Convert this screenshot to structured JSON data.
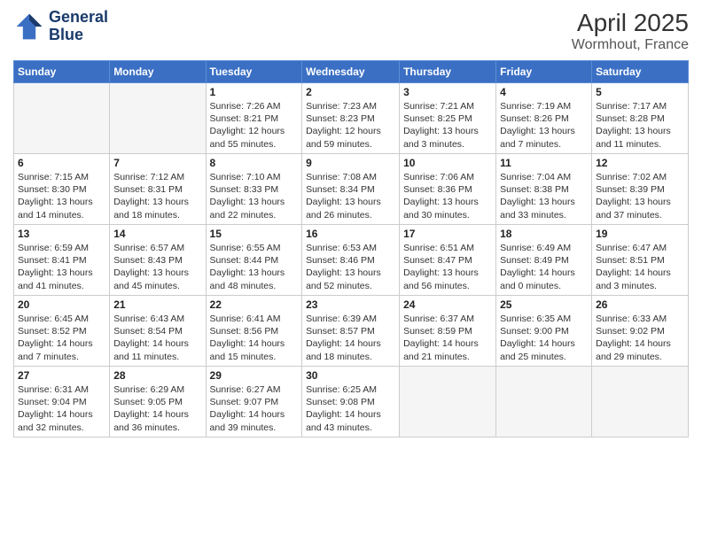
{
  "header": {
    "logo_line1": "General",
    "logo_line2": "Blue",
    "title": "April 2025",
    "subtitle": "Wormhout, France"
  },
  "days_of_week": [
    "Sunday",
    "Monday",
    "Tuesday",
    "Wednesday",
    "Thursday",
    "Friday",
    "Saturday"
  ],
  "weeks": [
    [
      {
        "day": "",
        "detail": ""
      },
      {
        "day": "",
        "detail": ""
      },
      {
        "day": "1",
        "detail": "Sunrise: 7:26 AM\nSunset: 8:21 PM\nDaylight: 12 hours\nand 55 minutes."
      },
      {
        "day": "2",
        "detail": "Sunrise: 7:23 AM\nSunset: 8:23 PM\nDaylight: 12 hours\nand 59 minutes."
      },
      {
        "day": "3",
        "detail": "Sunrise: 7:21 AM\nSunset: 8:25 PM\nDaylight: 13 hours\nand 3 minutes."
      },
      {
        "day": "4",
        "detail": "Sunrise: 7:19 AM\nSunset: 8:26 PM\nDaylight: 13 hours\nand 7 minutes."
      },
      {
        "day": "5",
        "detail": "Sunrise: 7:17 AM\nSunset: 8:28 PM\nDaylight: 13 hours\nand 11 minutes."
      }
    ],
    [
      {
        "day": "6",
        "detail": "Sunrise: 7:15 AM\nSunset: 8:30 PM\nDaylight: 13 hours\nand 14 minutes."
      },
      {
        "day": "7",
        "detail": "Sunrise: 7:12 AM\nSunset: 8:31 PM\nDaylight: 13 hours\nand 18 minutes."
      },
      {
        "day": "8",
        "detail": "Sunrise: 7:10 AM\nSunset: 8:33 PM\nDaylight: 13 hours\nand 22 minutes."
      },
      {
        "day": "9",
        "detail": "Sunrise: 7:08 AM\nSunset: 8:34 PM\nDaylight: 13 hours\nand 26 minutes."
      },
      {
        "day": "10",
        "detail": "Sunrise: 7:06 AM\nSunset: 8:36 PM\nDaylight: 13 hours\nand 30 minutes."
      },
      {
        "day": "11",
        "detail": "Sunrise: 7:04 AM\nSunset: 8:38 PM\nDaylight: 13 hours\nand 33 minutes."
      },
      {
        "day": "12",
        "detail": "Sunrise: 7:02 AM\nSunset: 8:39 PM\nDaylight: 13 hours\nand 37 minutes."
      }
    ],
    [
      {
        "day": "13",
        "detail": "Sunrise: 6:59 AM\nSunset: 8:41 PM\nDaylight: 13 hours\nand 41 minutes."
      },
      {
        "day": "14",
        "detail": "Sunrise: 6:57 AM\nSunset: 8:43 PM\nDaylight: 13 hours\nand 45 minutes."
      },
      {
        "day": "15",
        "detail": "Sunrise: 6:55 AM\nSunset: 8:44 PM\nDaylight: 13 hours\nand 48 minutes."
      },
      {
        "day": "16",
        "detail": "Sunrise: 6:53 AM\nSunset: 8:46 PM\nDaylight: 13 hours\nand 52 minutes."
      },
      {
        "day": "17",
        "detail": "Sunrise: 6:51 AM\nSunset: 8:47 PM\nDaylight: 13 hours\nand 56 minutes."
      },
      {
        "day": "18",
        "detail": "Sunrise: 6:49 AM\nSunset: 8:49 PM\nDaylight: 14 hours\nand 0 minutes."
      },
      {
        "day": "19",
        "detail": "Sunrise: 6:47 AM\nSunset: 8:51 PM\nDaylight: 14 hours\nand 3 minutes."
      }
    ],
    [
      {
        "day": "20",
        "detail": "Sunrise: 6:45 AM\nSunset: 8:52 PM\nDaylight: 14 hours\nand 7 minutes."
      },
      {
        "day": "21",
        "detail": "Sunrise: 6:43 AM\nSunset: 8:54 PM\nDaylight: 14 hours\nand 11 minutes."
      },
      {
        "day": "22",
        "detail": "Sunrise: 6:41 AM\nSunset: 8:56 PM\nDaylight: 14 hours\nand 15 minutes."
      },
      {
        "day": "23",
        "detail": "Sunrise: 6:39 AM\nSunset: 8:57 PM\nDaylight: 14 hours\nand 18 minutes."
      },
      {
        "day": "24",
        "detail": "Sunrise: 6:37 AM\nSunset: 8:59 PM\nDaylight: 14 hours\nand 21 minutes."
      },
      {
        "day": "25",
        "detail": "Sunrise: 6:35 AM\nSunset: 9:00 PM\nDaylight: 14 hours\nand 25 minutes."
      },
      {
        "day": "26",
        "detail": "Sunrise: 6:33 AM\nSunset: 9:02 PM\nDaylight: 14 hours\nand 29 minutes."
      }
    ],
    [
      {
        "day": "27",
        "detail": "Sunrise: 6:31 AM\nSunset: 9:04 PM\nDaylight: 14 hours\nand 32 minutes."
      },
      {
        "day": "28",
        "detail": "Sunrise: 6:29 AM\nSunset: 9:05 PM\nDaylight: 14 hours\nand 36 minutes."
      },
      {
        "day": "29",
        "detail": "Sunrise: 6:27 AM\nSunset: 9:07 PM\nDaylight: 14 hours\nand 39 minutes."
      },
      {
        "day": "30",
        "detail": "Sunrise: 6:25 AM\nSunset: 9:08 PM\nDaylight: 14 hours\nand 43 minutes."
      },
      {
        "day": "",
        "detail": ""
      },
      {
        "day": "",
        "detail": ""
      },
      {
        "day": "",
        "detail": ""
      }
    ]
  ]
}
